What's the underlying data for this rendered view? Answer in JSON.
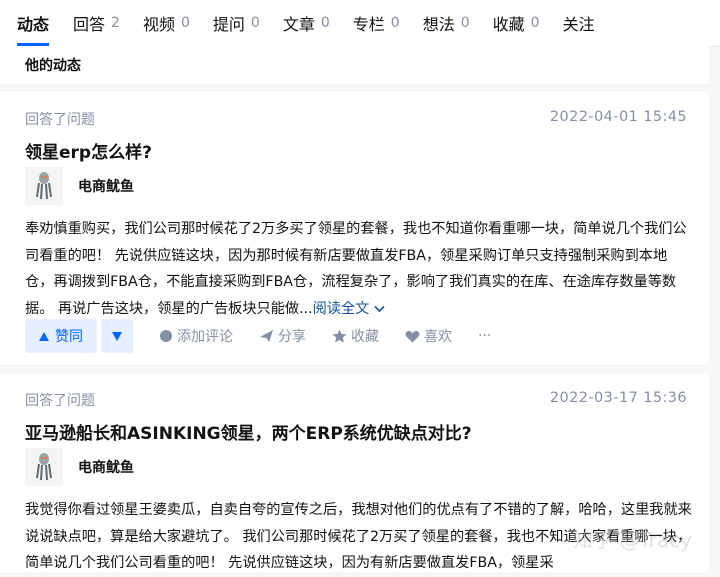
{
  "tabs": [
    {
      "label": "动态",
      "count": ""
    },
    {
      "label": "回答",
      "count": "2"
    },
    {
      "label": "视频",
      "count": "0"
    },
    {
      "label": "提问",
      "count": "0"
    },
    {
      "label": "文章",
      "count": "0"
    },
    {
      "label": "专栏",
      "count": "0"
    },
    {
      "label": "想法",
      "count": "0"
    },
    {
      "label": "收藏",
      "count": "0"
    },
    {
      "label": "关注",
      "count": ""
    }
  ],
  "section_title": "他的动态",
  "items": [
    {
      "action": "回答了问题",
      "date": "2022-04-01 15:45",
      "title": "领星erp怎么样?",
      "author": "电商鱿鱼",
      "excerpt": "奉劝慎重购买，我们公司那时候花了2万多买了领星的套餐，我也不知道你看重哪一块，简单说几个我们公司看重的吧！ 先说供应链这块，因为那时候有新店要做直发FBA，领星采购订单只支持强制采购到本地仓，再调拨到FBA仓，不能直接采购到FBA仓，流程复杂了，影响了我们真实的在库、在途库存数量等数据。 再说广告这块，领星的广告板块只能做...",
      "read_more": "阅读全文",
      "upvote": "赞同",
      "comment": "添加评论",
      "share": "分享",
      "favorite": "收藏",
      "like": "喜欢",
      "more": "···"
    },
    {
      "action": "回答了问题",
      "date": "2022-03-17 15:36",
      "title": "亚马逊船长和ASINKING领星，两个ERP系统优缺点对比?",
      "author": "电商鱿鱼",
      "excerpt": "我觉得你看过领星王婆卖瓜，自卖自夸的宣传之后，我想对他们的优点有了不错的了解，哈哈，这里我就来说说缺点吧，算是给大家避坑了。 我们公司那时候花了2万买了领星的套餐，我也不知道大家看重哪一块，简单说几个我们公司看重的吧！ 先说供应链这块，因为有新店要做直发FBA，领星采"
    }
  ],
  "watermark": "知乎 @Tracy"
}
